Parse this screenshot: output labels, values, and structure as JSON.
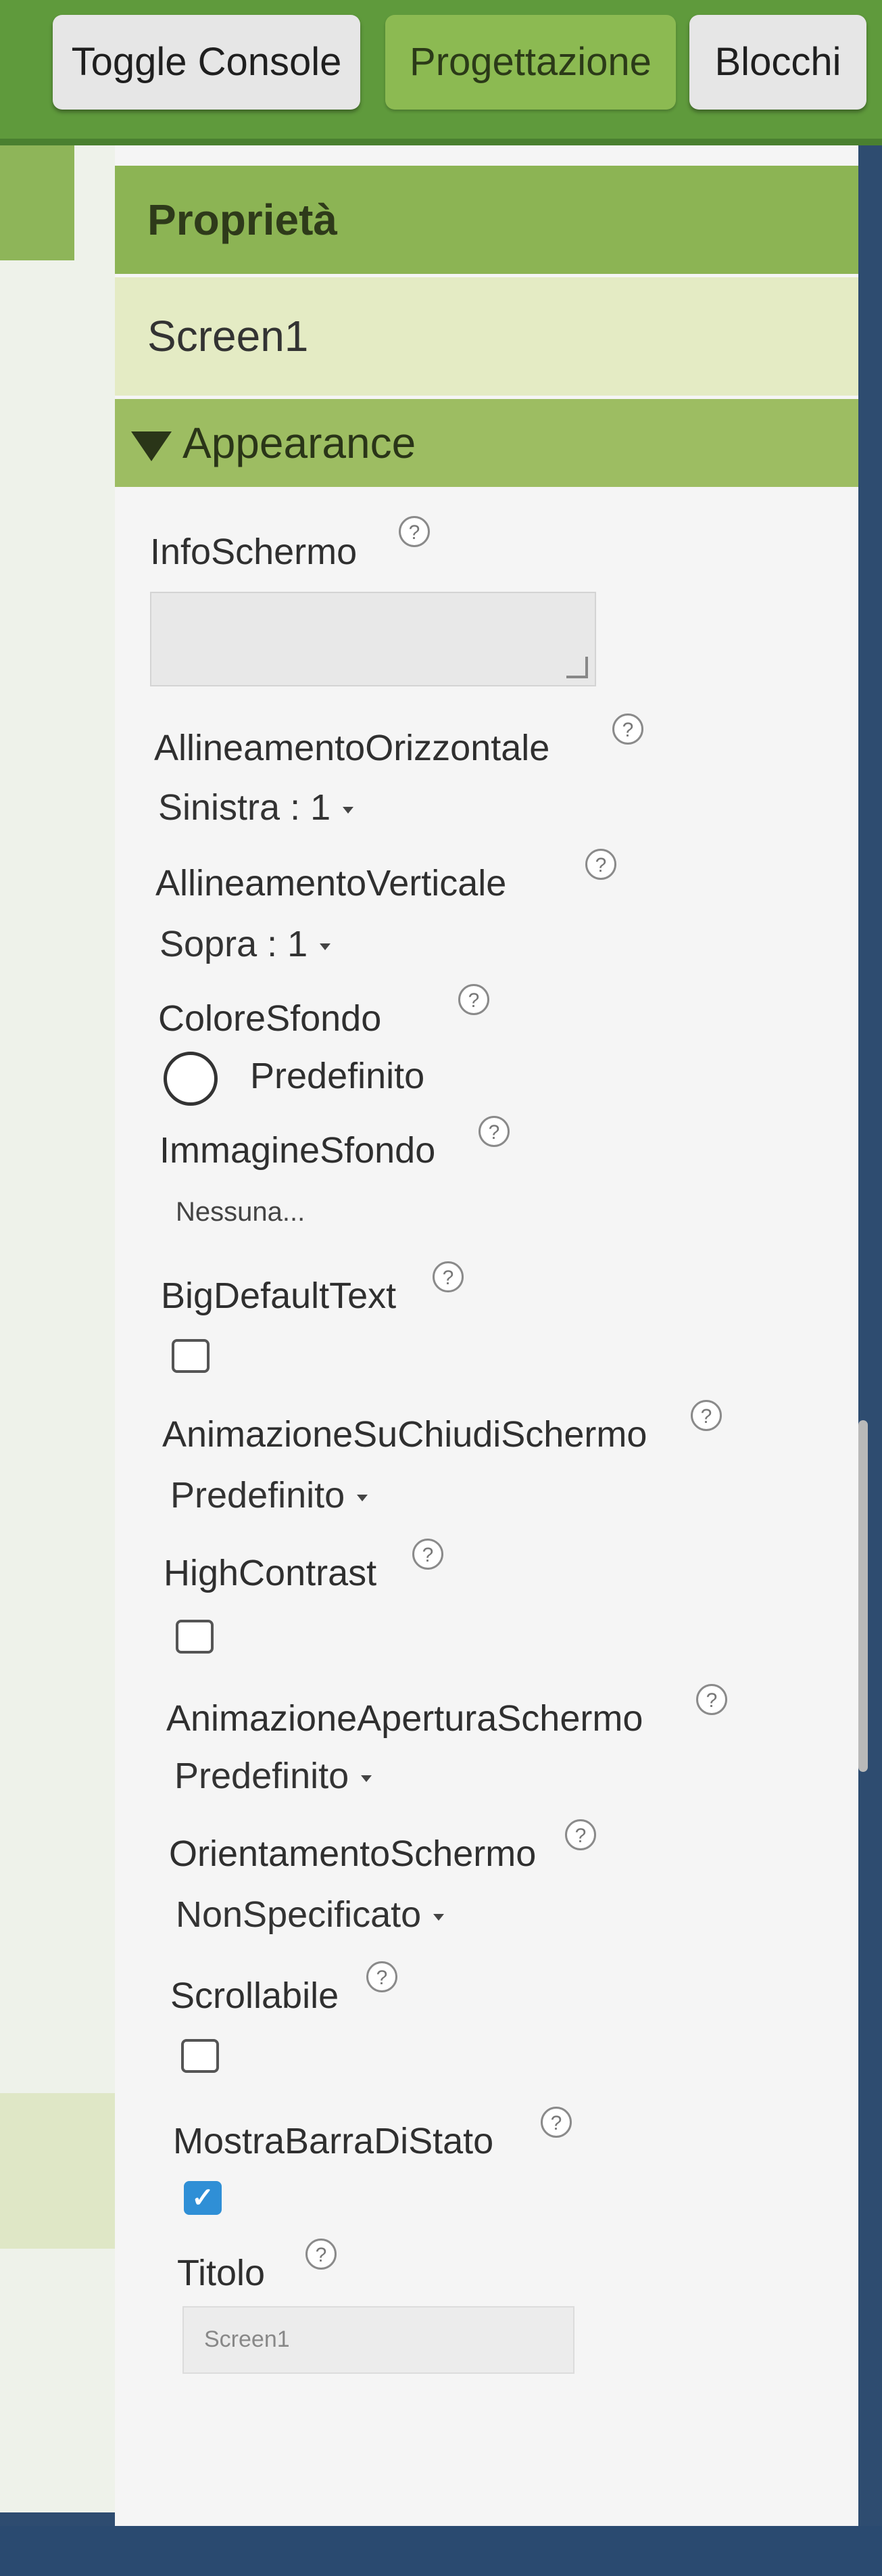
{
  "toolbar": {
    "toggle_console": "Toggle Console",
    "design": "Progettazione",
    "blocks": "Blocchi"
  },
  "properties": {
    "title": "Proprietà",
    "component": "Screen1",
    "group": "Appearance",
    "help_glyph": "?",
    "info_label": "InfoSchermo",
    "info_value": "",
    "align_h_label": "AllineamentoOrizzontale",
    "align_h_value": "Sinistra : 1",
    "align_v_label": "AllineamentoVerticale",
    "align_v_value": "Sopra : 1",
    "bgcolor_label": "ColoreSfondo",
    "bgcolor_value": "Predefinito",
    "bgimage_label": "ImmagineSfondo",
    "bgimage_value": "Nessuna...",
    "bigtext_label": "BigDefaultText",
    "bigtext_checked": false,
    "close_anim_label": "AnimazioneSuChiudiSchermo",
    "close_anim_value": "Predefinito",
    "contrast_label": "HighContrast",
    "contrast_checked": false,
    "open_anim_label": "AnimazioneAperturaSchermo",
    "open_anim_value": "Predefinito",
    "orientation_label": "OrientamentoSchermo",
    "orientation_value": "NonSpecificato",
    "scroll_label": "Scrollabile",
    "scroll_checked": false,
    "statusbar_label": "MostraBarraDiStato",
    "statusbar_checked": true,
    "statusbar_checkmark": "✓",
    "title_label": "Titolo",
    "title_value": "Screen1"
  },
  "colors": {
    "toolbar_green": "#5f9a3c",
    "panel_header": "#8cb454",
    "checkbox_blue": "#2f8fd6"
  }
}
